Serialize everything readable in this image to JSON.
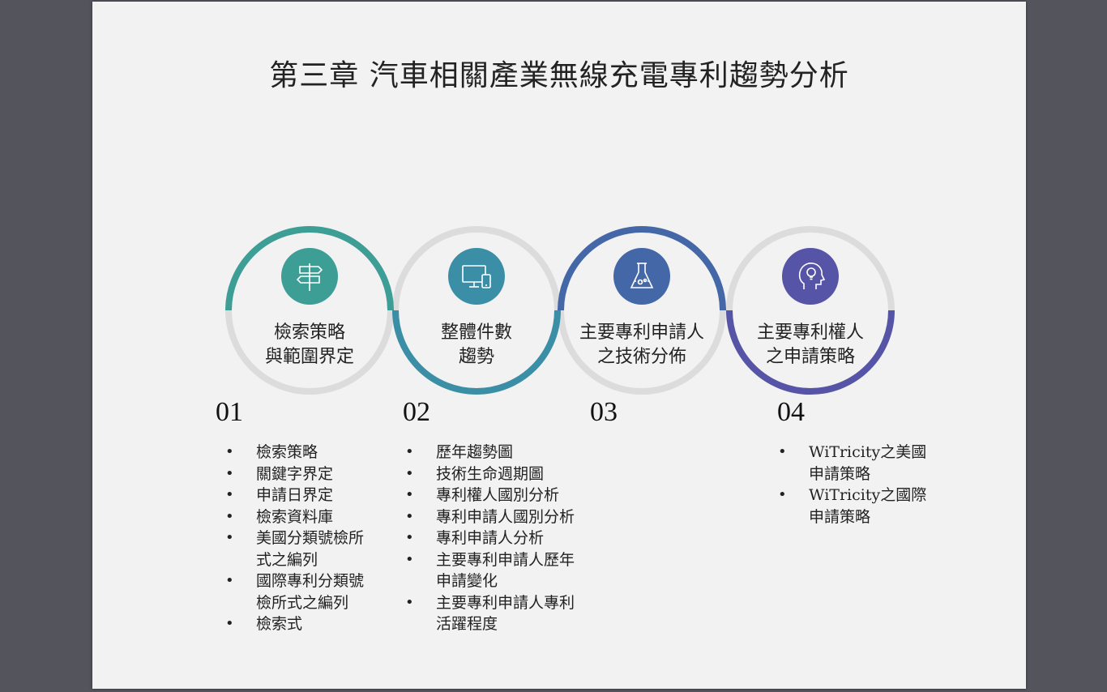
{
  "title": "第三章 汽車相關產業無線充電專利趨勢分析",
  "colors": {
    "step1": "#3d9e96",
    "step2": "#3a8fa6",
    "step3": "#4467a8",
    "step4": "#5654a6",
    "ring_gray": "#dcdcdc"
  },
  "steps": [
    {
      "number": "01",
      "label_line1": "檢索策略",
      "label_line2": "與範圍界定",
      "icon": "signpost-icon",
      "items": [
        "檢索策略",
        "關鍵字界定",
        "申請日界定",
        "檢索資料庫",
        "美國分類號檢所",
        "式之編列",
        "國際專利分類號",
        "檢所式之編列",
        "檢索式"
      ]
    },
    {
      "number": "02",
      "label_line1": "整體件數",
      "label_line2": "趨勢",
      "icon": "monitor-phone-icon",
      "items": [
        "歷年趨勢圖",
        "技術生命週期圖",
        "專利權人國別分析",
        "專利申請人國別分析",
        "專利申請人分析",
        "主要專利申請人歷年",
        "申請變化",
        "主要專利申請人專利",
        "活躍程度"
      ]
    },
    {
      "number": "03",
      "label_line1": "主要專利申請人",
      "label_line2": "之技術分佈",
      "icon": "flask-icon",
      "items": []
    },
    {
      "number": "04",
      "label_line1": "主要專利權人",
      "label_line2": "之申請策略",
      "icon": "head-lightbulb-icon",
      "items": [
        "WiTricity之美國",
        "申請策略",
        "WiTricity之國際",
        "申請策略"
      ]
    }
  ]
}
